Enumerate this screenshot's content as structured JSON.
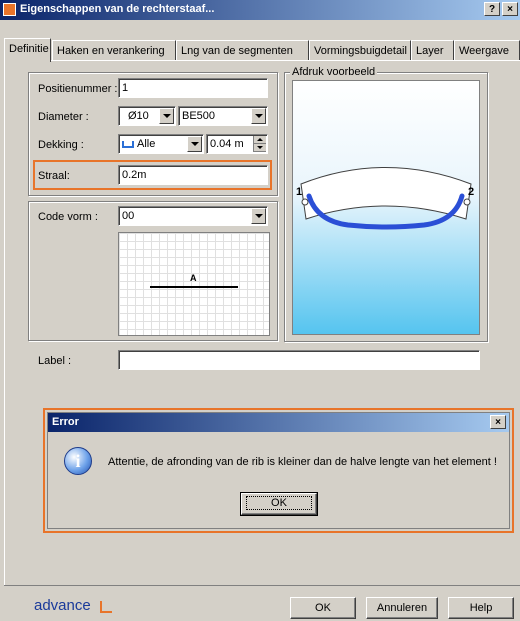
{
  "window": {
    "title": "Eigenschappen van de rechterstaaf...",
    "help_btn": "?",
    "close_btn": "×"
  },
  "tabs": [
    "Definitie",
    "Haken en verankering",
    "Lng van de segmenten",
    "Vormingsbuigdetail",
    "Layer",
    "Weergave"
  ],
  "form": {
    "positienummer_label": "Positienummer :",
    "positienummer_value": "1",
    "diameter_label": "Diameter :",
    "diameter_value": "Ø10",
    "steel_value": "BE500",
    "dekking_label": "Dekking :",
    "dekking_value": "Alle",
    "dekking_amount": "0.04 m",
    "straal_label": "Straal:",
    "straal_value": "0.2m",
    "code_label": "Code vorm :",
    "code_value": "00",
    "shape_letter": "A",
    "label_label": "Label :",
    "label_value": ""
  },
  "preview": {
    "title": "Afdruk voorbeeld",
    "point1": "1",
    "point2": "2"
  },
  "error": {
    "title": "Error",
    "close": "×",
    "message": "Attentie, de afronding van de rib is kleiner dan de halve lengte van het element !",
    "ok": "OK",
    "icon": "info-icon"
  },
  "footer": {
    "brand": "advance",
    "ok": "OK",
    "cancel": "Annuleren",
    "help": "Help"
  },
  "colors": {
    "highlight": "#e8742a",
    "rebar": "#2b4fd6",
    "titlebar": "#0a246a"
  }
}
